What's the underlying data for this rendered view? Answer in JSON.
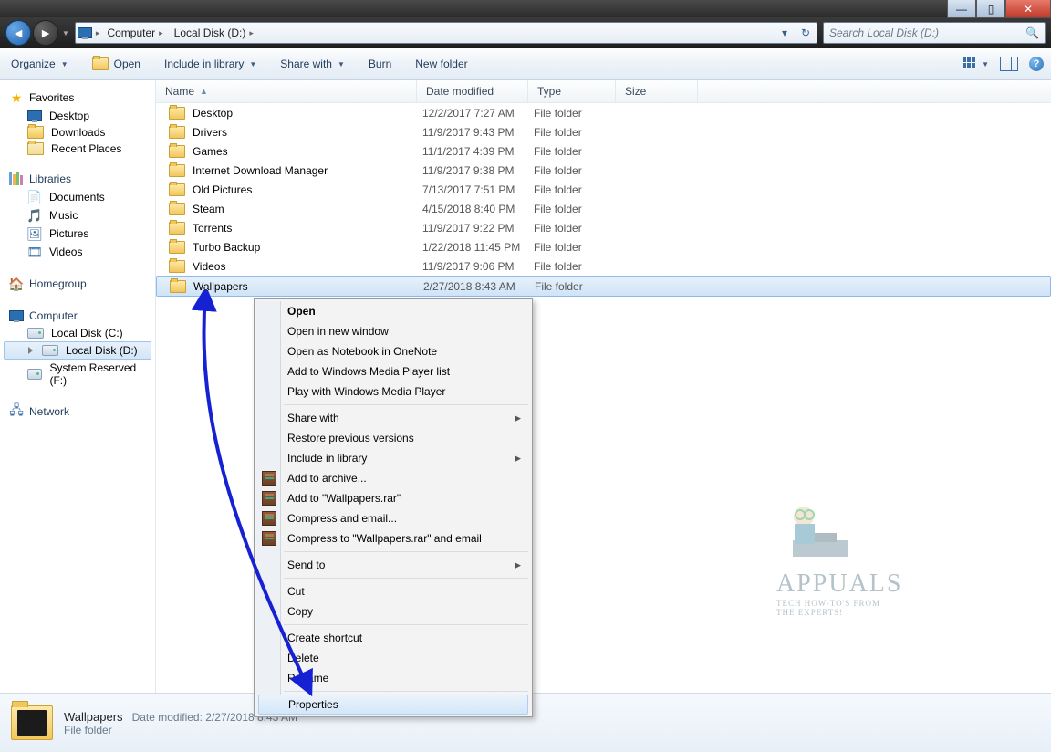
{
  "titlebar": {
    "min": "—",
    "max": "▯",
    "close": "✕"
  },
  "addressbar": {
    "crumbs": [
      "Computer",
      "Local Disk (D:)"
    ],
    "search_placeholder": "Search Local Disk (D:)"
  },
  "toolbar": {
    "organize": "Organize",
    "open": "Open",
    "include": "Include in library",
    "share": "Share with",
    "burn": "Burn",
    "newfolder": "New folder"
  },
  "sidebar": {
    "favorites": {
      "label": "Favorites",
      "items": [
        "Desktop",
        "Downloads",
        "Recent Places"
      ]
    },
    "libraries": {
      "label": "Libraries",
      "items": [
        "Documents",
        "Music",
        "Pictures",
        "Videos"
      ]
    },
    "homegroup": {
      "label": "Homegroup"
    },
    "computer": {
      "label": "Computer",
      "items": [
        "Local Disk (C:)",
        "Local Disk (D:)",
        "System Reserved (F:)"
      ]
    },
    "network": {
      "label": "Network"
    }
  },
  "columns": {
    "name": "Name",
    "date": "Date modified",
    "type": "Type",
    "size": "Size"
  },
  "rows": [
    {
      "name": "Desktop",
      "date": "12/2/2017 7:27 AM",
      "type": "File folder"
    },
    {
      "name": "Drivers",
      "date": "11/9/2017 9:43 PM",
      "type": "File folder"
    },
    {
      "name": "Games",
      "date": "11/1/2017 4:39 PM",
      "type": "File folder"
    },
    {
      "name": "Internet Download Manager",
      "date": "11/9/2017 9:38 PM",
      "type": "File folder"
    },
    {
      "name": "Old Pictures",
      "date": "7/13/2017 7:51 PM",
      "type": "File folder"
    },
    {
      "name": "Steam",
      "date": "4/15/2018 8:40 PM",
      "type": "File folder"
    },
    {
      "name": "Torrents",
      "date": "11/9/2017 9:22 PM",
      "type": "File folder"
    },
    {
      "name": "Turbo Backup",
      "date": "1/22/2018 11:45 PM",
      "type": "File folder"
    },
    {
      "name": "Videos",
      "date": "11/9/2017 9:06 PM",
      "type": "File folder"
    },
    {
      "name": "Wallpapers",
      "date": "2/27/2018 8:43 AM",
      "type": "File folder"
    }
  ],
  "context_menu": {
    "open": "Open",
    "open_new": "Open in new window",
    "open_onenote": "Open as Notebook in OneNote",
    "add_wmp_list": "Add to Windows Media Player list",
    "play_wmp": "Play with Windows Media Player",
    "share_with": "Share with",
    "restore": "Restore previous versions",
    "include_lib": "Include in library",
    "add_archive": "Add to archive...",
    "add_rar": "Add to \"Wallpapers.rar\"",
    "compress_email": "Compress and email...",
    "compress_rar_email": "Compress to \"Wallpapers.rar\" and email",
    "send_to": "Send to",
    "cut": "Cut",
    "copy": "Copy",
    "create_shortcut": "Create shortcut",
    "delete": "Delete",
    "rename": "Rename",
    "properties": "Properties"
  },
  "details": {
    "name": "Wallpapers",
    "date_label": "Date modified:",
    "date": "2/27/2018 8:43 AM",
    "type": "File folder"
  },
  "watermark": {
    "brand": "APPUALS",
    "tag1": "TECH HOW-TO'S FROM",
    "tag2": "THE EXPERTS!"
  }
}
